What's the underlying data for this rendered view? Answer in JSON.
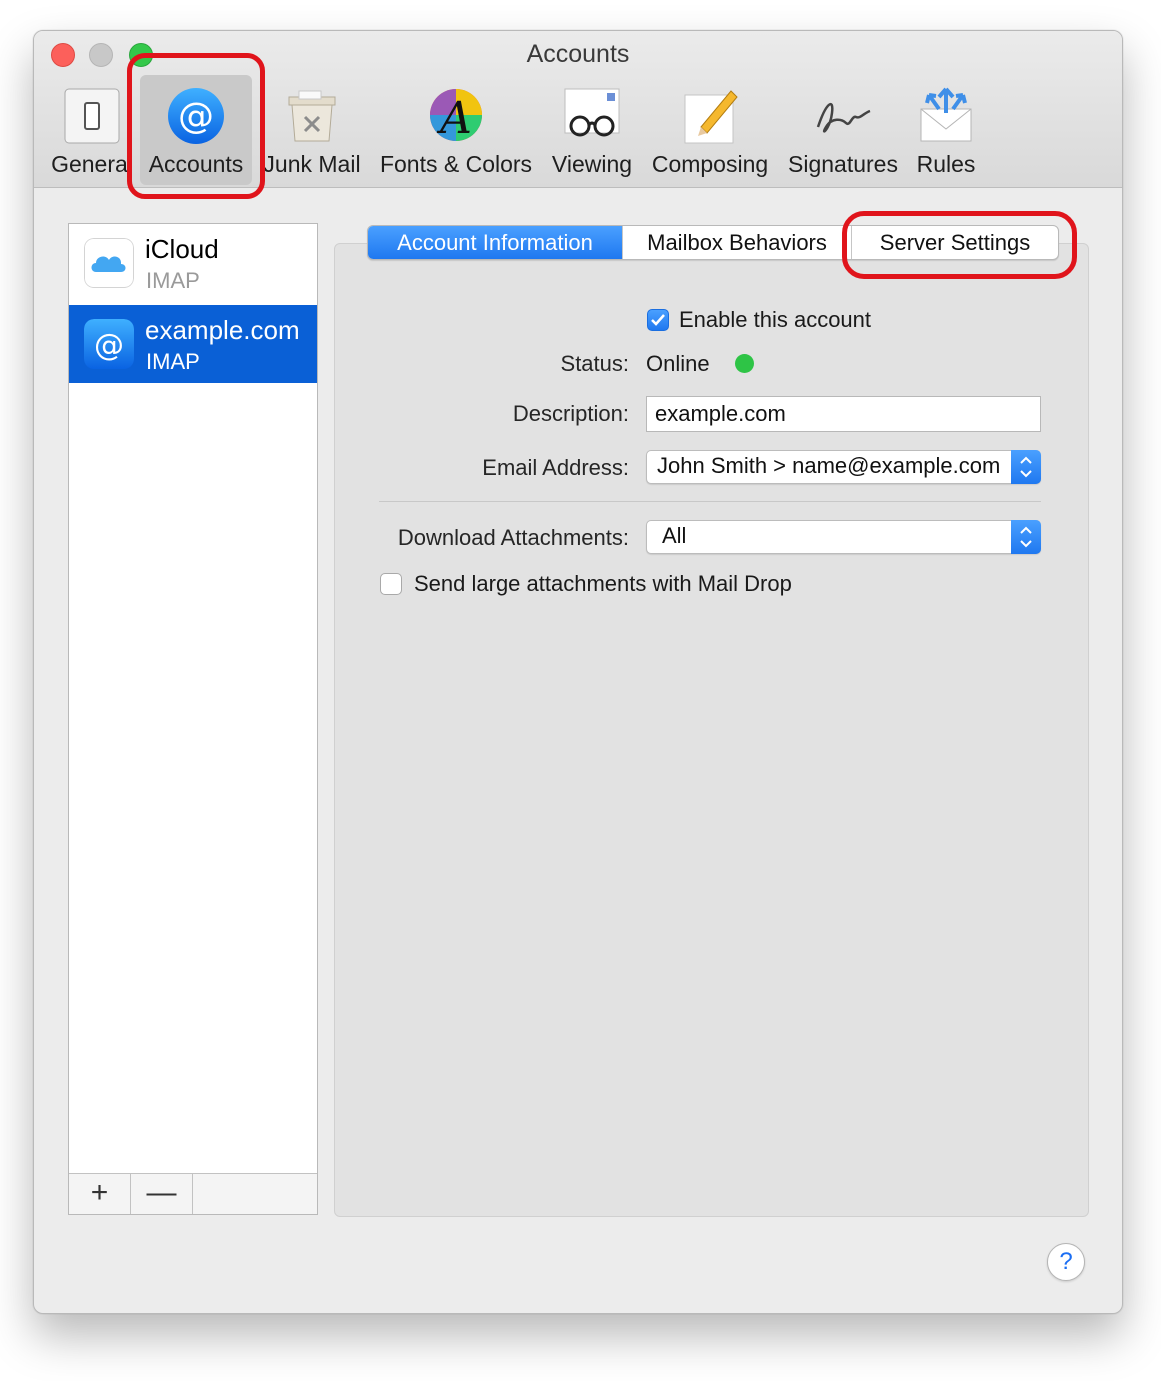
{
  "window": {
    "title": "Accounts"
  },
  "toolbar": {
    "items": [
      {
        "label": "General",
        "icon": "switch-icon"
      },
      {
        "label": "Accounts",
        "icon": "at-sign-icon"
      },
      {
        "label": "Junk Mail",
        "icon": "trash-icon"
      },
      {
        "label": "Fonts & Colors",
        "icon": "color-wheel-font-icon"
      },
      {
        "label": "Viewing",
        "icon": "glasses-icon"
      },
      {
        "label": "Composing",
        "icon": "pencil-paper-icon"
      },
      {
        "label": "Signatures",
        "icon": "signature-icon"
      },
      {
        "label": "Rules",
        "icon": "envelope-arrows-icon"
      }
    ],
    "selected": "Accounts"
  },
  "accounts": [
    {
      "name": "iCloud",
      "type": "IMAP",
      "icon": "icloud-icon"
    },
    {
      "name": "example.com",
      "type": "IMAP",
      "icon": "at-sign-icon",
      "selected": true
    }
  ],
  "list_footer": {
    "add": "+",
    "remove": "—"
  },
  "tabs": [
    {
      "label": "Account Information",
      "selected": true
    },
    {
      "label": "Mailbox Behaviors"
    },
    {
      "label": "Server Settings"
    }
  ],
  "form": {
    "enable_label": "Enable this account",
    "enable_checked": true,
    "status_label": "Status:",
    "status_value": "Online",
    "description_label": "Description:",
    "description_value": "example.com",
    "email_label": "Email Address:",
    "email_value": "John Smith > name@example.com",
    "download_label": "Download Attachments:",
    "download_value": "All",
    "maildrop_label": "Send large attachments with Mail Drop",
    "maildrop_checked": false
  },
  "help": {
    "label": "?"
  },
  "colors": {
    "accent": "#1f78f0",
    "selection": "#0a60d6",
    "online": "#2ec446",
    "highlight": "#e0141b"
  }
}
